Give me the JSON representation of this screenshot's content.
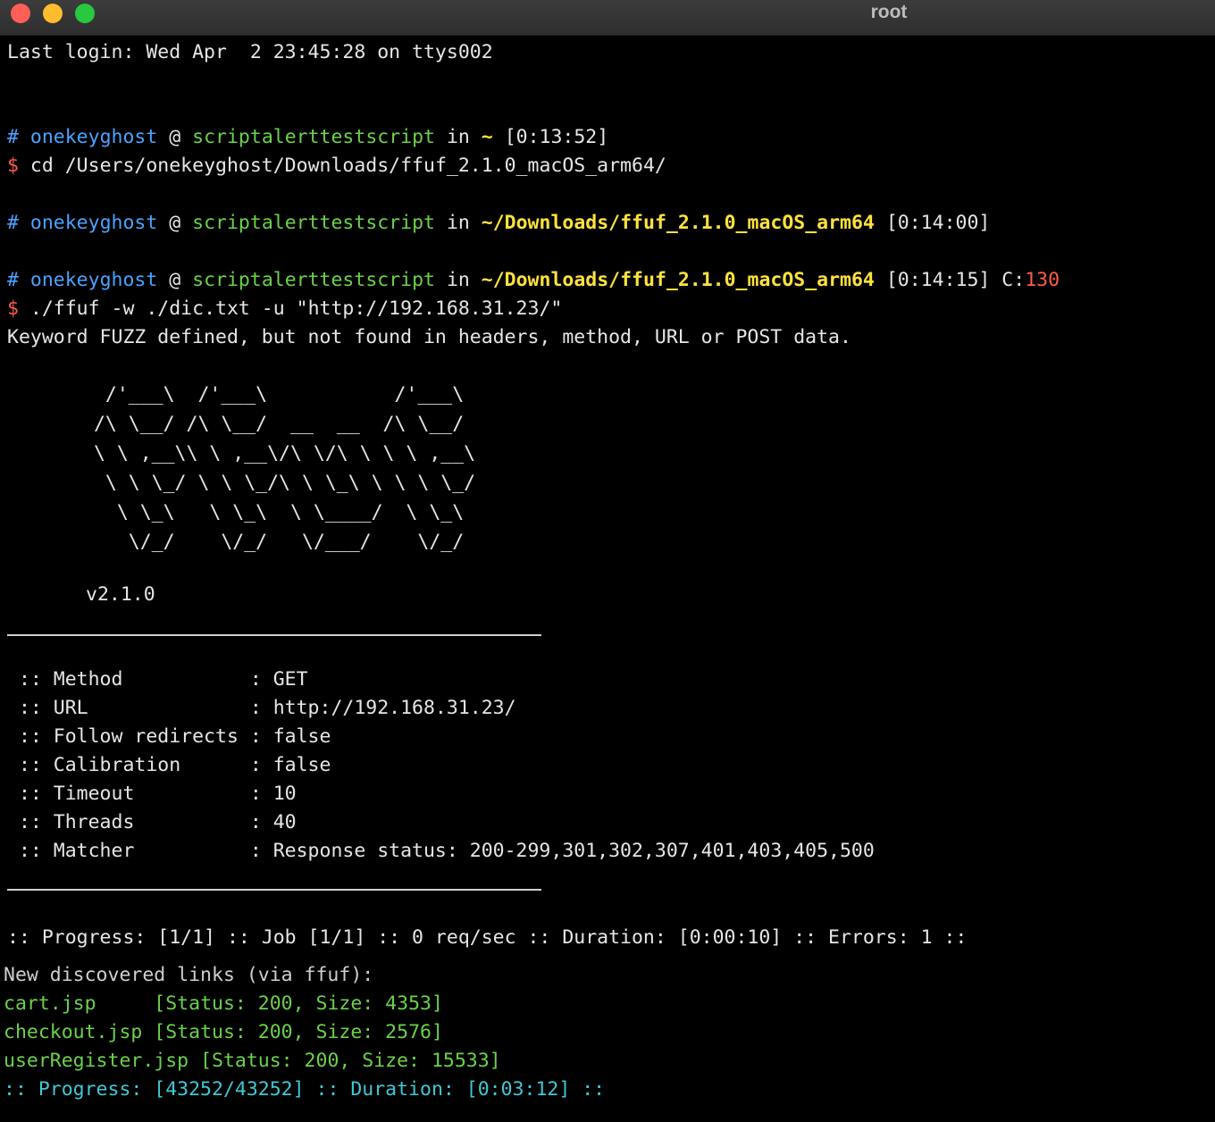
{
  "window": {
    "title": "root"
  },
  "terminal": {
    "last_login": "Last login: Wed Apr  2 23:45:28 on ttys002",
    "prompts": [
      {
        "hash": "#",
        "user": "onekeyghost",
        "at": "@",
        "host": "scriptalerttestscript",
        "in": "in",
        "path": "~",
        "time": "[0:13:52]",
        "exit_label": "",
        "exit_code": ""
      },
      {
        "hash": "#",
        "user": "onekeyghost",
        "at": "@",
        "host": "scriptalerttestscript",
        "in": "in",
        "path": "~/Downloads/ffuf_2.1.0_macOS_arm64",
        "time": "[0:14:00]",
        "exit_label": "",
        "exit_code": ""
      },
      {
        "hash": "#",
        "user": "onekeyghost",
        "at": "@",
        "host": "scriptalerttestscript",
        "in": "in",
        "path": "~/Downloads/ffuf_2.1.0_macOS_arm64",
        "time": "[0:14:15]",
        "exit_label": "C:",
        "exit_code": "130"
      }
    ],
    "commands": [
      {
        "sigil": "$",
        "text": "cd /Users/onekeyghost/Downloads/ffuf_2.1.0_macOS_arm64/"
      },
      {
        "sigil": "$",
        "text": "./ffuf -w ./dic.txt -u \"http://192.168.31.23/\""
      }
    ],
    "warning": "Keyword FUZZ defined, but not found in headers, method, URL or POST data.",
    "banner_ascii": "  /'___\\  /'___\\           /'___\\\n /\\ \\__/ /\\ \\__/  __  __  /\\ \\__/\n \\ \\ ,__\\\\ \\ ,__\\/\\ \\/\\ \\ \\ \\ ,__\\\n  \\ \\ \\_/ \\ \\ \\_/\\ \\ \\_\\ \\ \\ \\ \\_/\n   \\ \\_\\   \\ \\_\\  \\ \\____/  \\ \\_\\\n    \\/_/    \\/_/   \\/___/    \\/_/",
    "version": "v2.1.0",
    "config": [
      {
        "label": " :: Method           : ",
        "value": "GET"
      },
      {
        "label": " :: URL              : ",
        "value": "http://192.168.31.23/"
      },
      {
        "label": " :: Follow redirects : ",
        "value": "false"
      },
      {
        "label": " :: Calibration      : ",
        "value": "false"
      },
      {
        "label": " :: Timeout          : ",
        "value": "10"
      },
      {
        "label": " :: Threads          : ",
        "value": "40"
      },
      {
        "label": " :: Matcher          : ",
        "value": "Response status: 200-299,301,302,307,401,403,405,500"
      }
    ],
    "progress_line": ":: Progress: [1/1] :: Job [1/1] :: 0 req/sec :: Duration: [0:00:10] :: Errors: 1 ::",
    "discovered_header": "New discovered links (via ffuf):",
    "links": [
      {
        "name": "cart.jsp",
        "pad": "     ",
        "status": "[Status: 200, Size: 4353]"
      },
      {
        "name": "checkout.jsp",
        "pad": " ",
        "status": "[Status: 200, Size: 2576]"
      },
      {
        "name": "userRegister.jsp",
        "pad": " ",
        "status": "[Status: 200, Size: 15533]"
      }
    ],
    "final_progress": {
      "prefix": ":: Progress: ",
      "count": "[43252/43252]",
      "middle": " :: Duration: ",
      "duration": "[0:03:12]",
      "suffix": " ::"
    }
  },
  "colors": {
    "background": "#000000",
    "prompt_hash": "#4aa3ff",
    "user": "#4aa3ff",
    "host": "#6ad24a",
    "path": "#ffe23d",
    "sigil": "#ff5c4d",
    "exit_code": "#ff5c4d",
    "links": "#6ad24a",
    "final_progress": "#3fc9d6"
  }
}
